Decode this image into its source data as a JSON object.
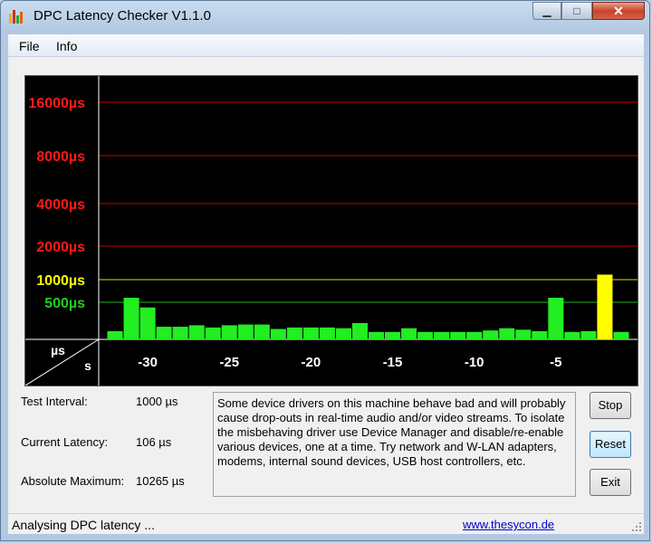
{
  "window": {
    "title": "DPC Latency Checker V1.1.0"
  },
  "menu": {
    "items": [
      "File",
      "Info"
    ]
  },
  "chart_data": {
    "type": "bar",
    "y_levels": [
      {
        "label": "16000µs",
        "value": 16000,
        "color": "#ff1a1a",
        "line": "#c00000"
      },
      {
        "label": "8000µs",
        "value": 8000,
        "color": "#ff1a1a",
        "line": "#c00000"
      },
      {
        "label": "4000µs",
        "value": 4000,
        "color": "#ff1a1a",
        "line": "#c00000"
      },
      {
        "label": "2000µs",
        "value": 2000,
        "color": "#ff1a1a",
        "line": "#c00000"
      },
      {
        "label": "1000µs",
        "value": 1000,
        "color": "#ffff00",
        "line": "#dada00"
      },
      {
        "label": "500µs",
        "value": 500,
        "color": "#22cc22",
        "line": "#1eb41e"
      }
    ],
    "corner_labels": {
      "top": "µs",
      "bottom": "s"
    },
    "x_ticks": [
      {
        "label": "-30",
        "value": -30
      },
      {
        "label": "-25",
        "value": -25
      },
      {
        "label": "-20",
        "value": -20
      },
      {
        "label": "-15",
        "value": -15
      },
      {
        "label": "-10",
        "value": -10
      },
      {
        "label": "-5",
        "value": -5
      }
    ],
    "x_range": [
      -33,
      0
    ],
    "x": [
      -32,
      -31,
      -30,
      -29,
      -28,
      -27,
      -26,
      -25,
      -24,
      -23,
      -22,
      -21,
      -20,
      -19,
      -18,
      -17,
      -16,
      -15,
      -14,
      -13,
      -12,
      -11,
      -10,
      -9,
      -8,
      -7,
      -6,
      -5,
      -4,
      -3,
      -2,
      -1
    ],
    "values": [
      110,
      600,
      430,
      170,
      170,
      190,
      160,
      190,
      200,
      200,
      140,
      160,
      160,
      160,
      150,
      220,
      100,
      100,
      150,
      100,
      100,
      100,
      100,
      120,
      150,
      130,
      110,
      600,
      100,
      110,
      1150,
      100
    ],
    "series": [
      {
        "color": "#22ee22",
        "highlight_color": "#ffff00"
      }
    ]
  },
  "stats": {
    "test_interval_label": "Test Interval:",
    "test_interval_value": "1000 µs",
    "current_latency_label": "Current Latency:",
    "current_latency_value": "106 µs",
    "absolute_maximum_label": "Absolute Maximum:",
    "absolute_maximum_value": "10265 µs"
  },
  "message": {
    "lines": [
      "Some device drivers on this machine behave bad and will probably",
      "cause drop-outs in real-time audio and/or video streams. To isolate",
      "the misbehaving driver use Device Manager and disable/re-enable",
      "various devices, one at a time. Try network and W-LAN adapters,",
      "modems, internal sound devices, USB host controllers, etc."
    ]
  },
  "buttons": {
    "stop": "Stop",
    "reset": "Reset",
    "exit": "Exit"
  },
  "status": {
    "text": "Analysing DPC latency ...",
    "link": "www.thesycon.de"
  }
}
